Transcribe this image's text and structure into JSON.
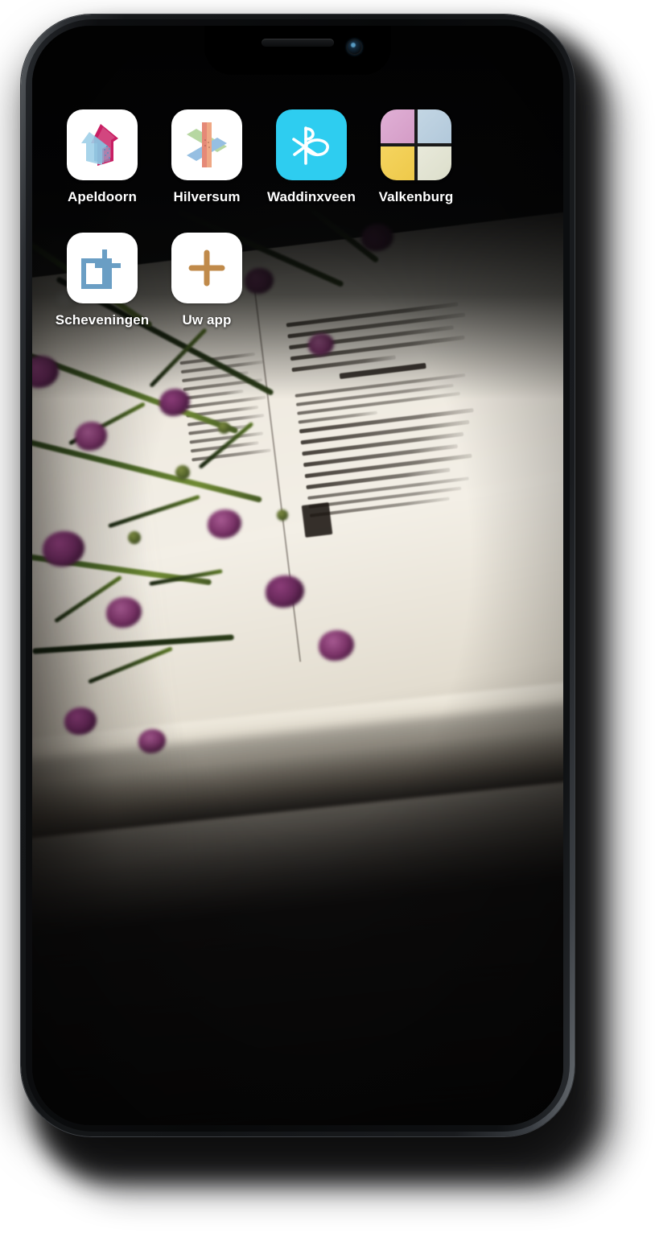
{
  "device": {
    "type": "smartphone-mockup",
    "frame_color": "#16181a",
    "screen_background": "#0b0c0d",
    "notch": {
      "speaker_label": "earpiece-speaker",
      "camera_label": "front-camera"
    },
    "buttons": [
      {
        "name": "silent-switch",
        "side": "left"
      },
      {
        "name": "volume-up-button",
        "side": "left"
      },
      {
        "name": "volume-down-button",
        "side": "left"
      },
      {
        "name": "power-button",
        "side": "right"
      }
    ]
  },
  "wallpaper": {
    "description": "open-bible-page-with-purple-wax-flowers",
    "dominant_colors": [
      "#0a0a0b",
      "#efeae0",
      "#6a2a5c",
      "#557322"
    ]
  },
  "home_screen": {
    "rows": [
      {
        "apps": [
          {
            "label": "Apeldoorn",
            "icon": "house-arrow-icon",
            "icon_bg": "#ffffff",
            "colors": [
              "#c81e63",
              "#9ecfe8"
            ]
          },
          {
            "label": "Hilversum",
            "icon": "snowflake-star-icon",
            "icon_bg": "#ffffff",
            "colors": [
              "#e0705a",
              "#7fb2dc",
              "#a8cf8e"
            ]
          },
          {
            "label": "Waddinxveen",
            "icon": "chi-rho-fish-icon",
            "icon_bg": "#2ecdf0",
            "colors": [
              "#ffffff"
            ]
          },
          {
            "label": "Valkenburg",
            "icon": "four-squares-icon",
            "icon_bg": "#1a1a1a",
            "colors": [
              "#dda8cf",
              "#b9cfe0",
              "#f2cf55",
              "#e2e4d2"
            ]
          }
        ]
      },
      {
        "apps": [
          {
            "label": "Scheveningen",
            "icon": "square-plus-icon",
            "icon_bg": "#ffffff",
            "colors": [
              "#6a9ec4"
            ]
          },
          {
            "label": "Uw app",
            "icon": "plus-icon",
            "icon_bg": "#ffffff",
            "colors": [
              "#c08a4a"
            ]
          }
        ]
      }
    ]
  }
}
